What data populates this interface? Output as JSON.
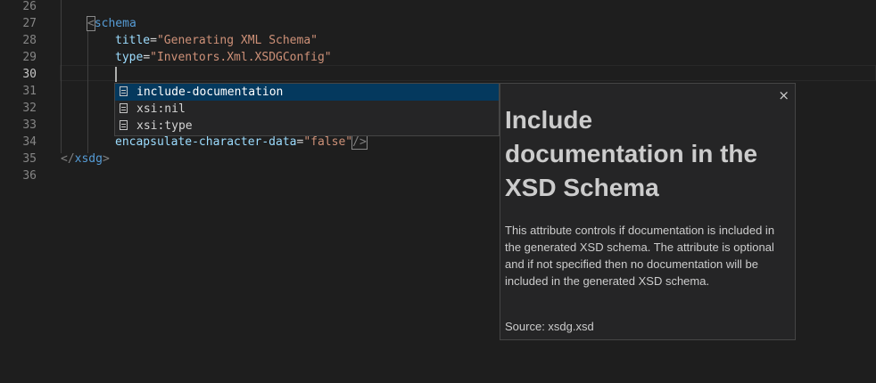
{
  "editor": {
    "lines": [
      {
        "num": "26"
      },
      {
        "num": "27",
        "open": "<",
        "tag": "schema"
      },
      {
        "num": "28",
        "attr": "title",
        "eq": "=",
        "value": "\"Generating XML Schema\""
      },
      {
        "num": "29",
        "attr": "type",
        "eq": "=",
        "value": "\"Inventors.Xml.XSDGConfig\""
      },
      {
        "num": "30"
      },
      {
        "num": "31"
      },
      {
        "num": "32"
      },
      {
        "num": "33"
      },
      {
        "num": "34",
        "attr": "encapsulate-character-data",
        "eq": "=",
        "value": "\"false\"",
        "close": "/>"
      },
      {
        "num": "35",
        "open": "</",
        "tag": "xsdg",
        "close": ">"
      },
      {
        "num": "36"
      }
    ]
  },
  "suggest": {
    "items": [
      {
        "label": "include-documentation",
        "icon": "property-icon"
      },
      {
        "label": "xsi:nil",
        "icon": "property-icon"
      },
      {
        "label": "xsi:type",
        "icon": "property-icon"
      }
    ]
  },
  "docs": {
    "close": "×",
    "title": "Include documentation in the XSD Schema",
    "body": "This attribute controls if documentation is included in the generated XSD schema. The attribute is optional and if not specified then no documentation will be included in the generated XSD schema.",
    "source": "Source: xsdg.xsd"
  }
}
